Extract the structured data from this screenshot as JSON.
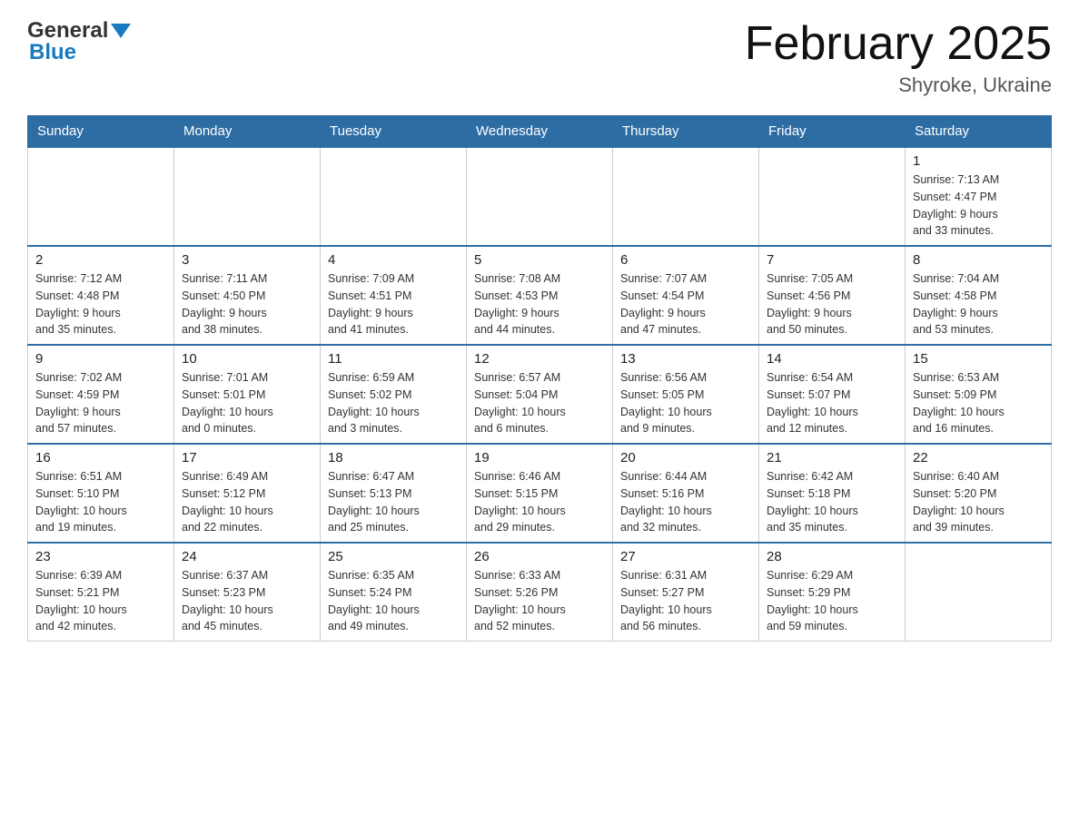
{
  "header": {
    "logo_line1": "General",
    "logo_line2": "Blue",
    "month_title": "February 2025",
    "location": "Shyroke, Ukraine"
  },
  "days_of_week": [
    "Sunday",
    "Monday",
    "Tuesday",
    "Wednesday",
    "Thursday",
    "Friday",
    "Saturday"
  ],
  "weeks": [
    {
      "days": [
        {
          "num": "",
          "info": ""
        },
        {
          "num": "",
          "info": ""
        },
        {
          "num": "",
          "info": ""
        },
        {
          "num": "",
          "info": ""
        },
        {
          "num": "",
          "info": ""
        },
        {
          "num": "",
          "info": ""
        },
        {
          "num": "1",
          "info": "Sunrise: 7:13 AM\nSunset: 4:47 PM\nDaylight: 9 hours\nand 33 minutes."
        }
      ]
    },
    {
      "days": [
        {
          "num": "2",
          "info": "Sunrise: 7:12 AM\nSunset: 4:48 PM\nDaylight: 9 hours\nand 35 minutes."
        },
        {
          "num": "3",
          "info": "Sunrise: 7:11 AM\nSunset: 4:50 PM\nDaylight: 9 hours\nand 38 minutes."
        },
        {
          "num": "4",
          "info": "Sunrise: 7:09 AM\nSunset: 4:51 PM\nDaylight: 9 hours\nand 41 minutes."
        },
        {
          "num": "5",
          "info": "Sunrise: 7:08 AM\nSunset: 4:53 PM\nDaylight: 9 hours\nand 44 minutes."
        },
        {
          "num": "6",
          "info": "Sunrise: 7:07 AM\nSunset: 4:54 PM\nDaylight: 9 hours\nand 47 minutes."
        },
        {
          "num": "7",
          "info": "Sunrise: 7:05 AM\nSunset: 4:56 PM\nDaylight: 9 hours\nand 50 minutes."
        },
        {
          "num": "8",
          "info": "Sunrise: 7:04 AM\nSunset: 4:58 PM\nDaylight: 9 hours\nand 53 minutes."
        }
      ]
    },
    {
      "days": [
        {
          "num": "9",
          "info": "Sunrise: 7:02 AM\nSunset: 4:59 PM\nDaylight: 9 hours\nand 57 minutes."
        },
        {
          "num": "10",
          "info": "Sunrise: 7:01 AM\nSunset: 5:01 PM\nDaylight: 10 hours\nand 0 minutes."
        },
        {
          "num": "11",
          "info": "Sunrise: 6:59 AM\nSunset: 5:02 PM\nDaylight: 10 hours\nand 3 minutes."
        },
        {
          "num": "12",
          "info": "Sunrise: 6:57 AM\nSunset: 5:04 PM\nDaylight: 10 hours\nand 6 minutes."
        },
        {
          "num": "13",
          "info": "Sunrise: 6:56 AM\nSunset: 5:05 PM\nDaylight: 10 hours\nand 9 minutes."
        },
        {
          "num": "14",
          "info": "Sunrise: 6:54 AM\nSunset: 5:07 PM\nDaylight: 10 hours\nand 12 minutes."
        },
        {
          "num": "15",
          "info": "Sunrise: 6:53 AM\nSunset: 5:09 PM\nDaylight: 10 hours\nand 16 minutes."
        }
      ]
    },
    {
      "days": [
        {
          "num": "16",
          "info": "Sunrise: 6:51 AM\nSunset: 5:10 PM\nDaylight: 10 hours\nand 19 minutes."
        },
        {
          "num": "17",
          "info": "Sunrise: 6:49 AM\nSunset: 5:12 PM\nDaylight: 10 hours\nand 22 minutes."
        },
        {
          "num": "18",
          "info": "Sunrise: 6:47 AM\nSunset: 5:13 PM\nDaylight: 10 hours\nand 25 minutes."
        },
        {
          "num": "19",
          "info": "Sunrise: 6:46 AM\nSunset: 5:15 PM\nDaylight: 10 hours\nand 29 minutes."
        },
        {
          "num": "20",
          "info": "Sunrise: 6:44 AM\nSunset: 5:16 PM\nDaylight: 10 hours\nand 32 minutes."
        },
        {
          "num": "21",
          "info": "Sunrise: 6:42 AM\nSunset: 5:18 PM\nDaylight: 10 hours\nand 35 minutes."
        },
        {
          "num": "22",
          "info": "Sunrise: 6:40 AM\nSunset: 5:20 PM\nDaylight: 10 hours\nand 39 minutes."
        }
      ]
    },
    {
      "days": [
        {
          "num": "23",
          "info": "Sunrise: 6:39 AM\nSunset: 5:21 PM\nDaylight: 10 hours\nand 42 minutes."
        },
        {
          "num": "24",
          "info": "Sunrise: 6:37 AM\nSunset: 5:23 PM\nDaylight: 10 hours\nand 45 minutes."
        },
        {
          "num": "25",
          "info": "Sunrise: 6:35 AM\nSunset: 5:24 PM\nDaylight: 10 hours\nand 49 minutes."
        },
        {
          "num": "26",
          "info": "Sunrise: 6:33 AM\nSunset: 5:26 PM\nDaylight: 10 hours\nand 52 minutes."
        },
        {
          "num": "27",
          "info": "Sunrise: 6:31 AM\nSunset: 5:27 PM\nDaylight: 10 hours\nand 56 minutes."
        },
        {
          "num": "28",
          "info": "Sunrise: 6:29 AM\nSunset: 5:29 PM\nDaylight: 10 hours\nand 59 minutes."
        },
        {
          "num": "",
          "info": ""
        }
      ]
    }
  ]
}
